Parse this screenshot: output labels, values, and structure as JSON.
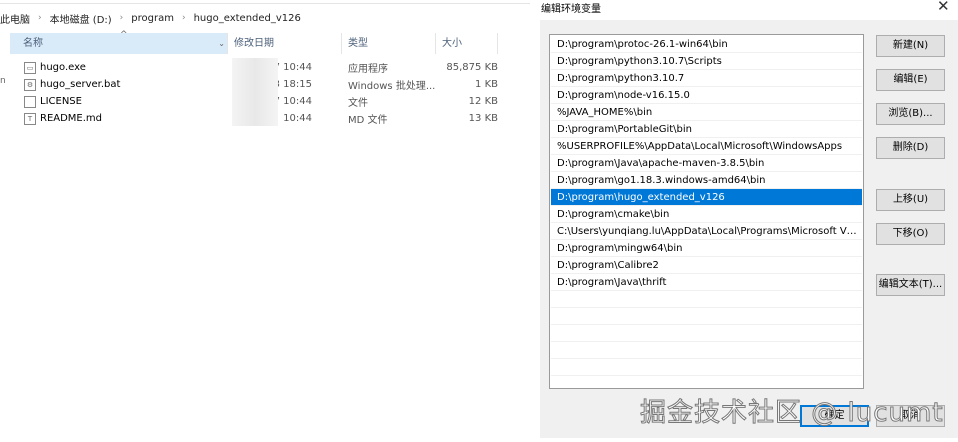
{
  "explorer": {
    "breadcrumb": [
      "此电脑",
      "本地磁盘 (D:)",
      "program",
      "hugo_extended_v126"
    ],
    "columns": {
      "name": "名称",
      "modified": "修改日期",
      "type": "类型",
      "size": "大小"
    },
    "files": [
      {
        "name": "hugo.exe",
        "modified": "7 10:44",
        "type": "应用程序",
        "size": "85,875 KB",
        "icon": "exe-icon"
      },
      {
        "name": "hugo_server.bat",
        "modified": "3 18:15",
        "type": "Windows 批处理...",
        "size": "1 KB",
        "icon": "bat-icon"
      },
      {
        "name": "LICENSE",
        "modified": "7 10:44",
        "type": "文件",
        "size": "12 KB",
        "icon": "file-icon"
      },
      {
        "name": "README.md",
        "modified": "10:44",
        "type": "MD 文件",
        "size": "13 KB",
        "icon": "text-file-icon"
      }
    ]
  },
  "dialog": {
    "title": "编辑环境变量",
    "close": "✕",
    "paths": [
      "D:\\program\\protoc-26.1-win64\\bin",
      "D:\\program\\python3.10.7\\Scripts",
      "D:\\program\\python3.10.7",
      "D:\\program\\node-v16.15.0",
      "%JAVA_HOME%\\bin",
      "D:\\program\\PortableGit\\bin",
      "%USERPROFILE%\\AppData\\Local\\Microsoft\\WindowsApps",
      "D:\\program\\Java\\apache-maven-3.8.5\\bin",
      "D:\\program\\go1.18.3.windows-amd64\\bin",
      "D:\\program\\hugo_extended_v126",
      "D:\\program\\cmake\\bin",
      "C:\\Users\\yunqiang.lu\\AppData\\Local\\Programs\\Microsoft VS Code\\bin",
      "D:\\program\\mingw64\\bin",
      "D:\\program\\Calibre2",
      "D:\\program\\Java\\thrift"
    ],
    "selected_index": 9,
    "buttons": {
      "new": "新建(N)",
      "edit": "编辑(E)",
      "browse": "浏览(B)...",
      "delete": "删除(D)",
      "up": "上移(U)",
      "down": "下移(O)",
      "edit_text": "编辑文本(T)...",
      "ok": "确定",
      "cancel": "取消"
    }
  },
  "watermark": "掘金技术社区 @ lucumt",
  "accent": "#0078d7"
}
